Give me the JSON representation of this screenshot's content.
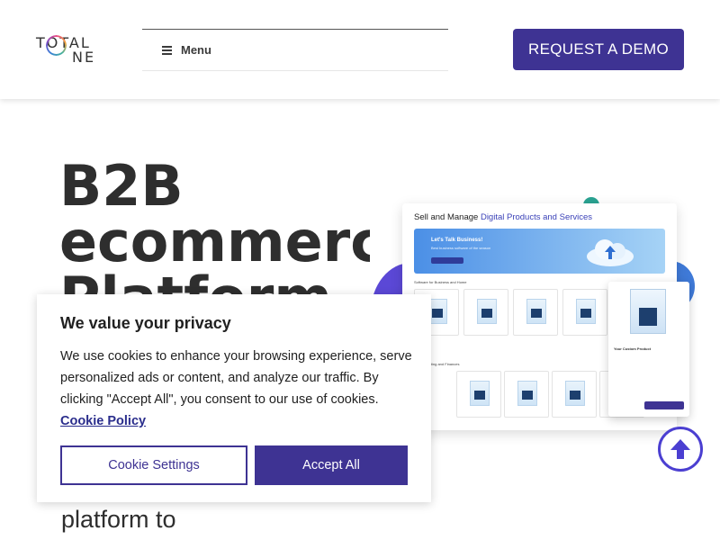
{
  "header": {
    "logo_line1": "TOTAL",
    "logo_line2": "NE",
    "menu_label": "Menu",
    "demo_button": "REQUEST A DEMO"
  },
  "hero": {
    "title_lines": [
      "B2B",
      "ecommerce",
      "Platform"
    ],
    "subtitle_fragment": "platform to"
  },
  "mockup": {
    "title_plain": "Sell and Manage ",
    "title_highlight": "Digital Products and Services",
    "banner_heading": "Let's Talk Business!",
    "banner_sub": "Best business software of the season",
    "row1_label": "Software for Business and Home",
    "row2_label": "for Accounting and Finances",
    "popup_title": "Your Custom Product"
  },
  "cookie": {
    "title": "We value your privacy",
    "body": "We use cookies to enhance your browsing experience, serve personalized ads or content, and analyze our traffic. By clicking \"Accept All\", you consent to our use of cookies.",
    "policy_link": "Cookie Policy",
    "settings_button": "Cookie Settings",
    "accept_button": "Accept All"
  },
  "colors": {
    "brand": "#3e3393",
    "text": "#2e2e2e",
    "accent_blue": "#3f7ad8",
    "accent_teal": "#2aa392"
  },
  "icons": {
    "menu": "hamburger-icon",
    "scroll": "arrow-up-circle-icon"
  }
}
